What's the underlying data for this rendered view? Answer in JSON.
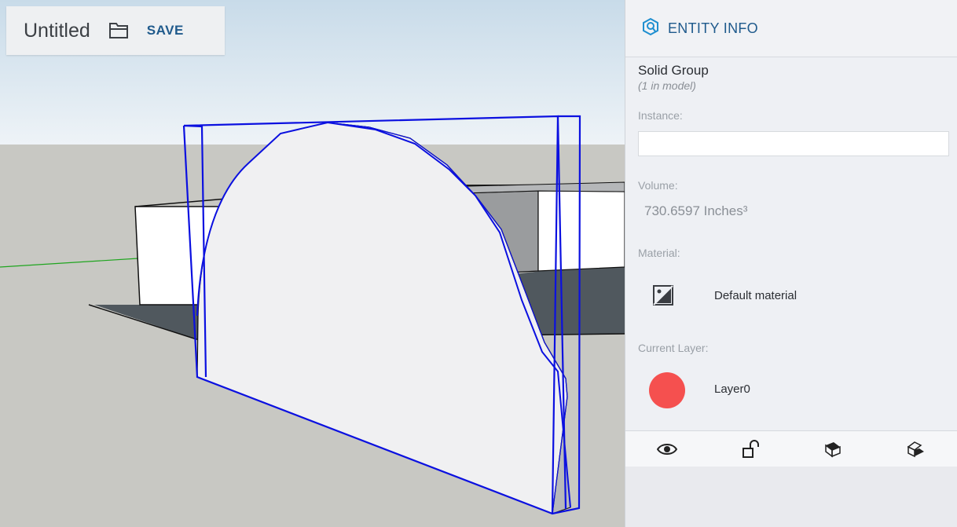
{
  "document": {
    "title": "Untitled",
    "open_icon": "folder-open-icon",
    "save_label": "SAVE"
  },
  "viewport": {
    "sky_top": "#c8dbe9",
    "sky_bottom": "#eef3f7",
    "ground": "#c8c8c3",
    "selection_color": "#0b10e0",
    "axis_green": "#1fa51f"
  },
  "entity_info": {
    "icon": "entity-info-icon",
    "title": "ENTITY INFO",
    "entity_type": "Solid Group",
    "entity_count": "(1 in model)",
    "instance_label": "Instance:",
    "instance_value": "",
    "volume_label": "Volume:",
    "volume_value": "730.6597 Inches³",
    "material_label": "Material:",
    "material_icon": "no-material-icon",
    "material_name": "Default material",
    "layer_label": "Current Layer:",
    "layer_name": "Layer0",
    "layer_color": "#f5504f",
    "accent": "#1f5a8c",
    "toolbar": [
      {
        "name": "visibility-eye-icon"
      },
      {
        "name": "unlock-icon"
      },
      {
        "name": "cast-shadows-icon"
      },
      {
        "name": "receive-shadows-icon"
      }
    ]
  }
}
